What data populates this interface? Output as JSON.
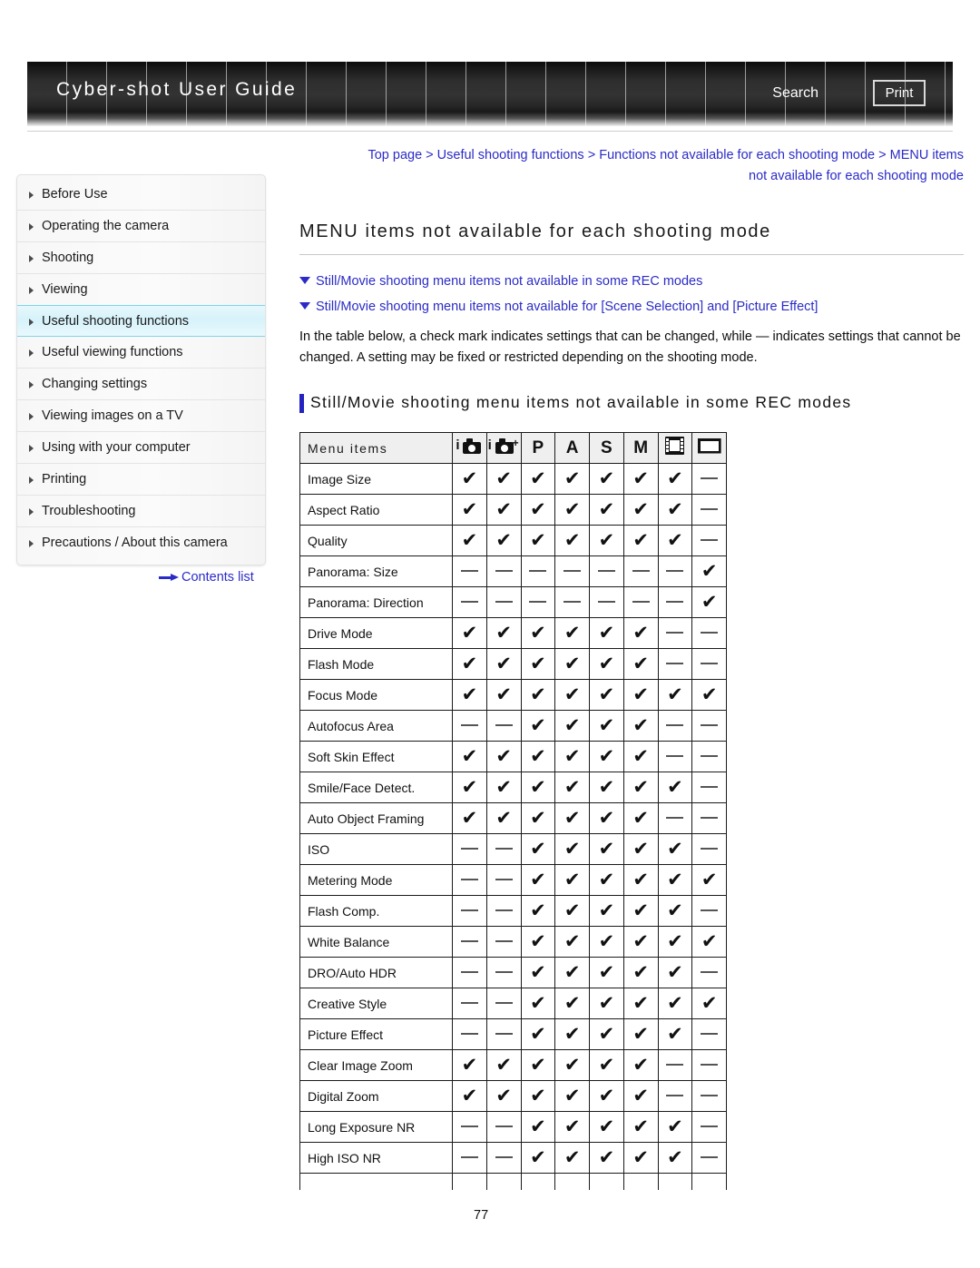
{
  "header": {
    "title": "Cyber-shot User Guide",
    "search_label": "Search",
    "print_label": "Print"
  },
  "sidebar": {
    "items": [
      {
        "label": "Before Use",
        "active": false
      },
      {
        "label": "Operating the camera",
        "active": false
      },
      {
        "label": "Shooting",
        "active": false
      },
      {
        "label": "Viewing",
        "active": false
      },
      {
        "label": "Useful shooting functions",
        "active": true
      },
      {
        "label": "Useful viewing functions",
        "active": false
      },
      {
        "label": "Changing settings",
        "active": false
      },
      {
        "label": "Viewing images on a TV",
        "active": false
      },
      {
        "label": "Using with your computer",
        "active": false
      },
      {
        "label": "Printing",
        "active": false
      },
      {
        "label": "Troubleshooting",
        "active": false
      },
      {
        "label": "Precautions / About this camera",
        "active": false
      }
    ],
    "contents_link": "Contents list"
  },
  "main": {
    "breadcrumb_line1": "Top page > Useful shooting functions > Functions not available for each shooting mode > MENU items",
    "breadcrumb_line2": "not available for each shooting mode",
    "page_title": "MENU items not available for each shooting mode",
    "jump_links": [
      "Still/Movie shooting menu items not available in some REC modes",
      "Still/Movie shooting menu items not available for [Scene Selection] and [Picture Effect]"
    ],
    "intro_text": "In the table below, a check mark indicates settings that can be changed, while — indicates settings that cannot be changed. A setting may be fixed or restricted depending on the shooting mode.",
    "section_heading": "Still/Movie shooting menu items not available in some REC modes",
    "page_number": "77"
  },
  "table": {
    "name_header": "Menu items",
    "mode_columns": [
      {
        "icon": "intelligent-auto-icon",
        "label": "iA"
      },
      {
        "icon": "superior-auto-icon",
        "label": "iA+"
      },
      {
        "icon": "program-auto-icon",
        "label": "P"
      },
      {
        "icon": "aperture-priority-icon",
        "label": "A"
      },
      {
        "icon": "shutter-priority-icon",
        "label": "S"
      },
      {
        "icon": "manual-exposure-icon",
        "label": "M"
      },
      {
        "icon": "movie-mode-icon",
        "label": "Movie"
      },
      {
        "icon": "panorama-mode-icon",
        "label": "Panorama"
      }
    ],
    "check_glyph": "✔",
    "rows": [
      {
        "name": "Image Size",
        "values": [
          "check",
          "check",
          "check",
          "check",
          "check",
          "check",
          "check",
          "dash"
        ]
      },
      {
        "name": "Aspect Ratio",
        "values": [
          "check",
          "check",
          "check",
          "check",
          "check",
          "check",
          "check",
          "dash"
        ]
      },
      {
        "name": "Quality",
        "values": [
          "check",
          "check",
          "check",
          "check",
          "check",
          "check",
          "check",
          "dash"
        ]
      },
      {
        "name": "Panorama: Size",
        "values": [
          "dash",
          "dash",
          "dash",
          "dash",
          "dash",
          "dash",
          "dash",
          "check"
        ]
      },
      {
        "name": "Panorama: Direction",
        "values": [
          "dash",
          "dash",
          "dash",
          "dash",
          "dash",
          "dash",
          "dash",
          "check"
        ]
      },
      {
        "name": "Drive Mode",
        "values": [
          "check",
          "check",
          "check",
          "check",
          "check",
          "check",
          "dash",
          "dash"
        ]
      },
      {
        "name": "Flash Mode",
        "values": [
          "check",
          "check",
          "check",
          "check",
          "check",
          "check",
          "dash",
          "dash"
        ]
      },
      {
        "name": "Focus Mode",
        "values": [
          "check",
          "check",
          "check",
          "check",
          "check",
          "check",
          "check",
          "check"
        ]
      },
      {
        "name": "Autofocus Area",
        "values": [
          "dash",
          "dash",
          "check",
          "check",
          "check",
          "check",
          "dash",
          "dash"
        ]
      },
      {
        "name": "Soft Skin Effect",
        "values": [
          "check",
          "check",
          "check",
          "check",
          "check",
          "check",
          "dash",
          "dash"
        ]
      },
      {
        "name": "Smile/Face Detect.",
        "values": [
          "check",
          "check",
          "check",
          "check",
          "check",
          "check",
          "check",
          "dash"
        ]
      },
      {
        "name": "Auto Object Framing",
        "values": [
          "check",
          "check",
          "check",
          "check",
          "check",
          "check",
          "dash",
          "dash"
        ]
      },
      {
        "name": "ISO",
        "values": [
          "dash",
          "dash",
          "check",
          "check",
          "check",
          "check",
          "check",
          "dash"
        ]
      },
      {
        "name": "Metering Mode",
        "values": [
          "dash",
          "dash",
          "check",
          "check",
          "check",
          "check",
          "check",
          "check"
        ]
      },
      {
        "name": "Flash Comp.",
        "values": [
          "dash",
          "dash",
          "check",
          "check",
          "check",
          "check",
          "check",
          "dash"
        ]
      },
      {
        "name": "White Balance",
        "values": [
          "dash",
          "dash",
          "check",
          "check",
          "check",
          "check",
          "check",
          "check"
        ]
      },
      {
        "name": "DRO/Auto HDR",
        "values": [
          "dash",
          "dash",
          "check",
          "check",
          "check",
          "check",
          "check",
          "dash"
        ]
      },
      {
        "name": "Creative Style",
        "values": [
          "dash",
          "dash",
          "check",
          "check",
          "check",
          "check",
          "check",
          "check"
        ]
      },
      {
        "name": "Picture Effect",
        "values": [
          "dash",
          "dash",
          "check",
          "check",
          "check",
          "check",
          "check",
          "dash"
        ]
      },
      {
        "name": "Clear Image Zoom",
        "values": [
          "check",
          "check",
          "check",
          "check",
          "check",
          "check",
          "dash",
          "dash"
        ]
      },
      {
        "name": "Digital Zoom",
        "values": [
          "check",
          "check",
          "check",
          "check",
          "check",
          "check",
          "dash",
          "dash"
        ]
      },
      {
        "name": "Long Exposure NR",
        "values": [
          "dash",
          "dash",
          "check",
          "check",
          "check",
          "check",
          "check",
          "dash"
        ]
      },
      {
        "name": "High ISO NR",
        "values": [
          "dash",
          "dash",
          "check",
          "check",
          "check",
          "check",
          "check",
          "dash"
        ]
      }
    ]
  }
}
